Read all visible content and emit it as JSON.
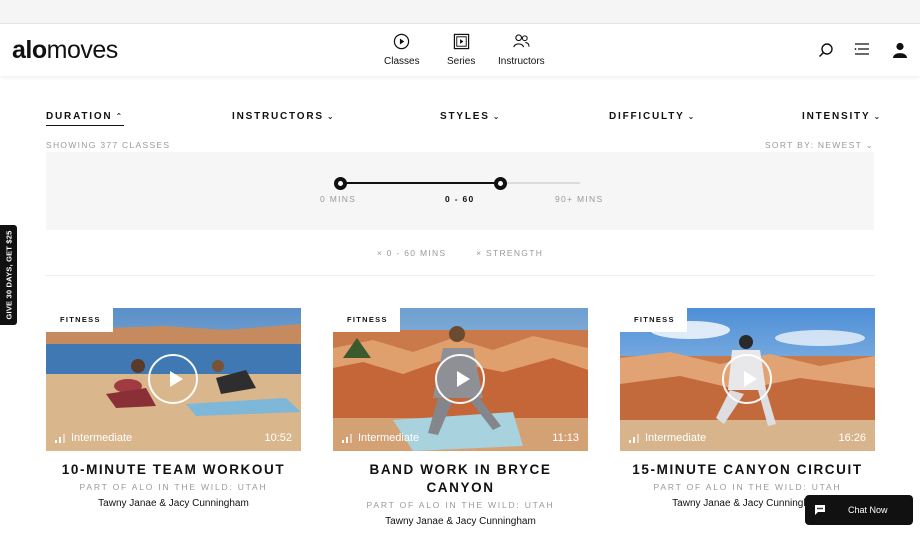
{
  "brand": {
    "logo_bold": "alo",
    "logo_light": "moves"
  },
  "nav": {
    "tabs": [
      {
        "label": "Classes",
        "icon": "play-circle-icon"
      },
      {
        "label": "Series",
        "icon": "stacked-play-icon"
      },
      {
        "label": "Instructors",
        "icon": "people-icon"
      }
    ],
    "right_icons": [
      "search-icon",
      "menu-list-icon",
      "user-icon"
    ]
  },
  "filters": [
    {
      "label": "DURATION",
      "chevron": "⌃",
      "active": true
    },
    {
      "label": "INSTRUCTORS",
      "chevron": "⌄"
    },
    {
      "label": "STYLES",
      "chevron": "⌄"
    },
    {
      "label": "DIFFICULTY",
      "chevron": "⌄"
    },
    {
      "label": "INTENSITY",
      "chevron": "⌄"
    }
  ],
  "results": {
    "showing": "SHOWING 377 CLASSES",
    "sort": "SORT BY: NEWEST ⌄"
  },
  "duration_slider": {
    "min_label": "0 MINS",
    "current_label": "0 - 60",
    "max_label": "90+ MINS",
    "low_value": 0,
    "high_value": 60,
    "max_value": 90
  },
  "active_filters": [
    "× 0 - 60 MINS",
    "× STRENGTH"
  ],
  "promo_tab": "GIVE 30 DAYS, GET $25",
  "cards": [
    {
      "tag": "FITNESS",
      "level": "Intermediate",
      "duration": "10:52",
      "title": "10-MINUTE TEAM WORKOUT",
      "series": "PART OF ALO IN THE WILD: UTAH",
      "instructors": "Tawny Janae & Jacy Cunningham"
    },
    {
      "tag": "FITNESS",
      "level": "Intermediate",
      "duration": "11:13",
      "title": "BAND WORK IN BRYCE CANYON",
      "series": "PART OF ALO IN THE WILD: UTAH",
      "instructors": "Tawny Janae & Jacy Cunningham"
    },
    {
      "tag": "FITNESS",
      "level": "Intermediate",
      "duration": "16:26",
      "title": "15-MINUTE CANYON CIRCUIT",
      "series": "PART OF ALO IN THE WILD: UTAH",
      "instructors": "Tawny Janae & Jacy Cunningham"
    }
  ],
  "chat": {
    "label": "Chat Now"
  },
  "colors": {
    "accent": "#111111",
    "muted": "#9a9a9a",
    "panel": "#f6f6f6"
  }
}
